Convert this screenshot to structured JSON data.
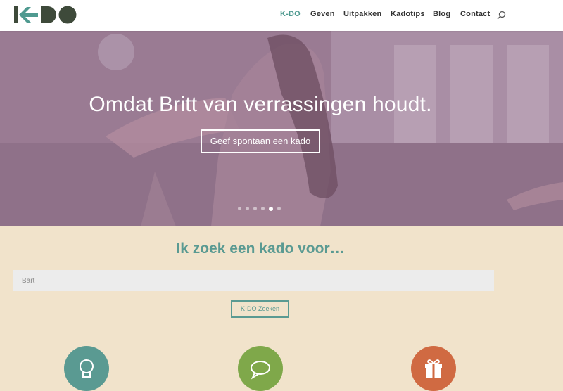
{
  "header": {
    "logo_alt": "K-DO",
    "nav": [
      {
        "label": "K-DO",
        "active": true
      },
      {
        "label": "Geven",
        "active": false
      },
      {
        "label": "Uitpakken",
        "active": false
      },
      {
        "label": "Kadotips",
        "active": false
      },
      {
        "label": "Blog",
        "active": false
      },
      {
        "label": "Contact",
        "active": false
      }
    ],
    "search_icon": "search-icon"
  },
  "hero": {
    "title": "Omdat Britt van verrassingen houdt.",
    "button_label": "Geef spontaan een kado",
    "slides_total": 6,
    "active_slide": 5
  },
  "search_section": {
    "title": "Ik zoek een kado voor…",
    "input_value": "",
    "input_placeholder": "Bart",
    "button_label": "K-DO Zoeken"
  },
  "features": [
    {
      "icon": "lightbulb-icon",
      "color": "#5a9a92"
    },
    {
      "icon": "speech-bubble-icon",
      "color": "#7fa84a"
    },
    {
      "icon": "gift-icon",
      "color": "#d06a42"
    }
  ],
  "colors": {
    "accent": "#5a9a92",
    "background": "#f1e3cb",
    "hero_overlay": "#977891"
  }
}
